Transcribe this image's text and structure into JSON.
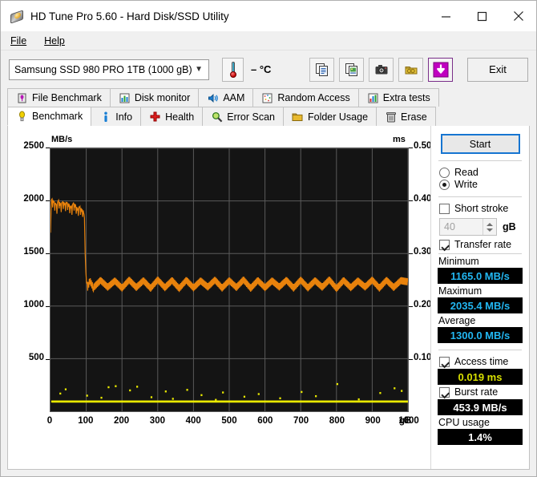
{
  "window": {
    "title": "HD Tune Pro 5.60 - Hard Disk/SSD Utility",
    "app_icon": "hard-disk-icon",
    "minimize": "minimize-icon",
    "maximize": "maximize-icon",
    "close": "close-icon"
  },
  "menu": {
    "items": [
      {
        "label": "File",
        "accel": "F"
      },
      {
        "label": "Help",
        "accel": "H"
      }
    ]
  },
  "toolbar": {
    "drive": "Samsung SSD 980 PRO 1TB (1000 gB)",
    "dropdown_icon": "chevron-down-icon",
    "thermometer_icon": "thermometer-icon",
    "temperature": "– °C",
    "buttons": [
      {
        "name": "copy-text-icon",
        "title": "Copy text"
      },
      {
        "name": "copy-image-icon",
        "title": "Copy image"
      },
      {
        "name": "screenshot-icon",
        "title": "Screenshot"
      },
      {
        "name": "save-icon",
        "title": "Save"
      },
      {
        "name": "download-icon",
        "title": "Download"
      }
    ],
    "exit_label": "Exit"
  },
  "tabs": {
    "row1": [
      {
        "label": "File Benchmark",
        "icon": "file-benchmark-icon",
        "active": false
      },
      {
        "label": "Disk monitor",
        "icon": "bar-chart-icon",
        "active": false
      },
      {
        "label": "AAM",
        "icon": "speaker-icon",
        "active": false
      },
      {
        "label": "Random Access",
        "icon": "random-access-icon",
        "active": false
      },
      {
        "label": "Extra tests",
        "icon": "extra-tests-icon",
        "active": false
      }
    ],
    "row2": [
      {
        "label": "Benchmark",
        "icon": "bulb-icon",
        "active": true
      },
      {
        "label": "Info",
        "icon": "info-icon",
        "active": false
      },
      {
        "label": "Health",
        "icon": "health-cross-icon",
        "active": false
      },
      {
        "label": "Error Scan",
        "icon": "magnifier-icon",
        "active": false
      },
      {
        "label": "Folder Usage",
        "icon": "folder-icon",
        "active": false
      },
      {
        "label": "Erase",
        "icon": "trash-icon",
        "active": false
      }
    ]
  },
  "sidebar": {
    "start_label": "Start",
    "mode_read": "Read",
    "mode_write": "Write",
    "mode_selected": "Write",
    "short_stroke_label": "Short stroke",
    "short_stroke_checked": false,
    "short_stroke_value": "40",
    "short_stroke_unit": "gB",
    "transfer_rate_label": "Transfer rate",
    "transfer_rate_checked": true,
    "minimum_label": "Minimum",
    "minimum_value": "1165.0 MB/s",
    "maximum_label": "Maximum",
    "maximum_value": "2035.4 MB/s",
    "average_label": "Average",
    "average_value": "1300.0 MB/s",
    "access_time_label": "Access time",
    "access_time_checked": true,
    "access_time_value": "0.019 ms",
    "burst_rate_label": "Burst rate",
    "burst_rate_checked": true,
    "burst_rate_value": "453.9 MB/s",
    "cpu_usage_label": "CPU usage",
    "cpu_usage_value": "1.4%"
  },
  "colors": {
    "transfer_curve": "#e8820c",
    "access_dots": "#eaea00",
    "value_cyan": "#22b7f2",
    "value_yellow": "#d8e000",
    "plot_background": "#141414",
    "grid": "#5a5a5a",
    "focus_blue": "#1675d1",
    "accent_magenta": "#c000c0"
  },
  "chart_data": {
    "type": "line",
    "title": "",
    "xlabel": "gB",
    "ylabel": "MB/s",
    "y2label": "ms",
    "xlim": [
      0,
      1000
    ],
    "ylim": [
      0,
      2500
    ],
    "y2lim": [
      0,
      0.5
    ],
    "grid": true,
    "xticks": [
      0,
      100,
      200,
      300,
      400,
      500,
      600,
      700,
      800,
      900,
      1000
    ],
    "yticks": [
      500,
      1000,
      1500,
      2000,
      2500
    ],
    "y2ticks": [
      0.1,
      0.2,
      0.3,
      0.4,
      0.5
    ],
    "legend": [],
    "series": [
      {
        "name": "Transfer rate",
        "axis": "left",
        "unit": "MB/s",
        "color": "#e8820c",
        "description": "SLC cache plateau near 2000 MB/s for first ~95 gB, sharp drop to steady ~1200 MB/s oscillating band for the remainder",
        "x": [
          0,
          3,
          6,
          9,
          12,
          15,
          18,
          21,
          24,
          27,
          30,
          33,
          36,
          39,
          42,
          45,
          48,
          51,
          54,
          57,
          60,
          63,
          66,
          69,
          72,
          75,
          78,
          81,
          84,
          87,
          90,
          93,
          95,
          97,
          99,
          101,
          104,
          110,
          120,
          140,
          160,
          180,
          200,
          220,
          240,
          260,
          280,
          300,
          320,
          340,
          360,
          380,
          400,
          420,
          440,
          460,
          480,
          500,
          520,
          540,
          560,
          580,
          600,
          620,
          640,
          660,
          680,
          700,
          720,
          740,
          760,
          780,
          800,
          820,
          840,
          860,
          880,
          900,
          920,
          940,
          960,
          980,
          1000
        ],
        "y": [
          1720,
          2035,
          1960,
          2010,
          1930,
          1990,
          1900,
          2020,
          1950,
          1985,
          1915,
          2005,
          1945,
          1990,
          1925,
          2000,
          1935,
          1975,
          1905,
          1960,
          1890,
          1995,
          1930,
          1970,
          1900,
          1940,
          1880,
          1960,
          1890,
          1930,
          1870,
          1905,
          1835,
          1500,
          1320,
          1215,
          1180,
          1240,
          1175,
          1245,
          1180,
          1240,
          1172,
          1248,
          1178,
          1242,
          1170,
          1250,
          1176,
          1244,
          1168,
          1246,
          1174,
          1240,
          1182,
          1248,
          1172,
          1242,
          1178,
          1250,
          1170,
          1244,
          1176,
          1240,
          1182,
          1246,
          1172,
          1248,
          1174,
          1242,
          1180,
          1250,
          1168,
          1244,
          1176,
          1240,
          1182,
          1248,
          1172,
          1246,
          1178,
          1242,
          1230
        ]
      },
      {
        "name": "Access time",
        "axis": "right",
        "unit": "ms",
        "color": "#eaea00",
        "style": "scatter",
        "description": "Dense baseline near 0.019 ms across the whole span with sparse higher outliers up to ~0.055 ms",
        "baseline_ms": 0.019,
        "x": [
          10,
          25,
          40,
          60,
          80,
          100,
          120,
          140,
          160,
          180,
          200,
          220,
          240,
          260,
          280,
          300,
          320,
          340,
          360,
          380,
          400,
          420,
          440,
          460,
          480,
          500,
          520,
          540,
          560,
          580,
          600,
          620,
          640,
          660,
          680,
          700,
          720,
          740,
          760,
          780,
          800,
          820,
          840,
          860,
          880,
          900,
          920,
          940,
          960,
          980
        ],
        "y": [
          0.019,
          0.034,
          0.042,
          0.019,
          0.019,
          0.03,
          0.019,
          0.026,
          0.046,
          0.048,
          0.019,
          0.04,
          0.047,
          0.019,
          0.027,
          0.019,
          0.038,
          0.024,
          0.019,
          0.041,
          0.019,
          0.031,
          0.019,
          0.022,
          0.036,
          0.019,
          0.019,
          0.028,
          0.019,
          0.033,
          0.019,
          0.019,
          0.025,
          0.019,
          0.019,
          0.037,
          0.019,
          0.029,
          0.019,
          0.019,
          0.052,
          0.019,
          0.019,
          0.023,
          0.019,
          0.019,
          0.035,
          0.019,
          0.044,
          0.039
        ]
      }
    ]
  }
}
